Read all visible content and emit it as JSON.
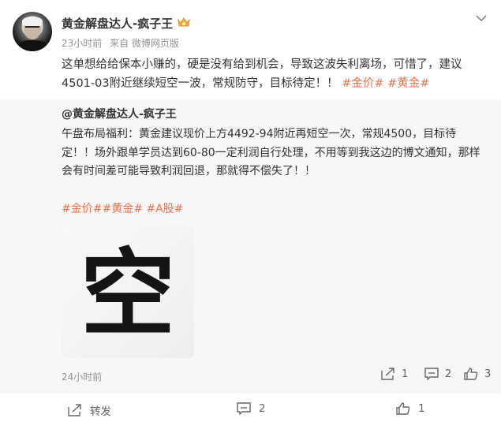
{
  "post": {
    "author": "黄金解盘达人-疯子王",
    "time": "23小时前",
    "source": "来自 微博网页版",
    "text": "这单想给给保本小赚的，硬是没有给到机会，导致这波失利离场，可惜了，建议4501-03附近继续短空一波，常规防守，目标待定！！",
    "tags": [
      "#金价#",
      "#黄金#"
    ],
    "icons": {
      "vip": "vip-crown-icon",
      "menu": "chevron-down-icon"
    }
  },
  "repost": {
    "author": "@黄金解盘达人-疯子王",
    "text": "午盘布局福利：黄金建议现价上方4492-94附近再短空一次，常规4500，目标待定！！场外跟单学员达到60-80一定利润自行处理，不用等到我这边的博文通知，那样会有时间差可能导致利润回退，那就得不偿失了！！",
    "tags": "#金价##黄金# #A股#",
    "image_char": "空",
    "time": "24小时前",
    "share_count": "1",
    "comment_count": "2",
    "like_count": "3"
  },
  "footer": {
    "share_label": "转发",
    "comment_count": "2",
    "like_count": "1"
  },
  "colors": {
    "accent": "#eb7350",
    "text": "#333333",
    "meta": "#939393",
    "repost_bg": "#f7f7f7"
  }
}
